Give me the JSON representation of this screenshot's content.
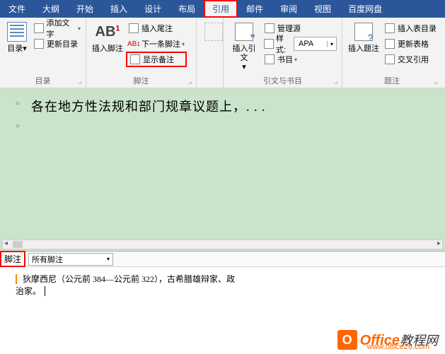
{
  "menu": {
    "items": [
      "文件",
      "大纲",
      "开始",
      "插入",
      "设计",
      "布局",
      "引用",
      "邮件",
      "审阅",
      "视图",
      "百度网盘"
    ],
    "active_index": 6
  },
  "ribbon": {
    "toc": {
      "big": "目录",
      "add_text": "添加文字",
      "update": "更新目录",
      "group": "目录"
    },
    "footnote": {
      "big": "插入脚注",
      "insert_end": "插入尾注",
      "next": "下一条脚注",
      "show_notes": "显示备注",
      "group": "脚注"
    },
    "cite": {
      "big": "插入引文",
      "manage": "管理源",
      "style_label": "样式:",
      "style_value": "APA",
      "biblio": "书目",
      "group": "引文与书目"
    },
    "caption": {
      "big": "插入题注",
      "insert_tof": "插入表目录",
      "update_table": "更新表格",
      "crossref": "交叉引用",
      "group": "题注"
    },
    "unknown": {
      "big": ""
    }
  },
  "document": {
    "line1": "各在地方性法规和部门规章议题上，. . ."
  },
  "footpane": {
    "label": "脚注",
    "selector": "所有脚注",
    "note_text_a": "狄摩西尼（公元前 384—公元前 322），古希腊雄辩家、政",
    "note_text_b": "治家。"
  },
  "watermark": {
    "brand1": "Office",
    "brand2": "教程网",
    "url": "www.office26.com"
  }
}
